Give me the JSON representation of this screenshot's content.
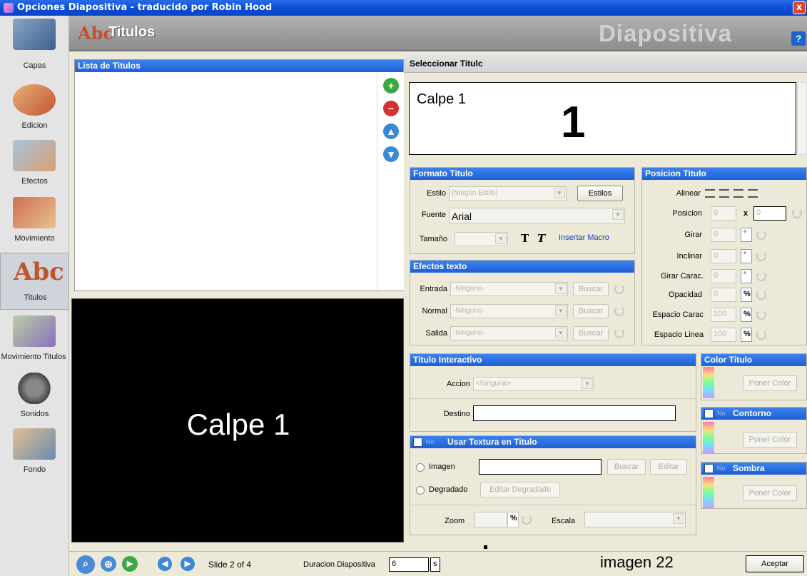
{
  "window": {
    "title": "Opciones Diapositiva - traducido por Robin Hood",
    "close": "x"
  },
  "sidebar": {
    "items": [
      {
        "label": "Capas"
      },
      {
        "label": "Edicion"
      },
      {
        "label": "Efectos"
      },
      {
        "label": "Movimiento"
      },
      {
        "label": "Titulos"
      },
      {
        "label": "Movimiento Titulos"
      },
      {
        "label": "Sonidos"
      },
      {
        "label": "Fondo"
      }
    ]
  },
  "header": {
    "title": "Titulos",
    "watermark": "Diapositiva",
    "help": "?"
  },
  "lista": {
    "title": "Lista de Titulos"
  },
  "preview": {
    "text": "Calpe 1"
  },
  "select": {
    "title": "Seleccionar Titulc",
    "text": "Calpe 1",
    "overlay_number": "1"
  },
  "formato": {
    "title": "Formato Titulo",
    "estilo_label": "Estilo",
    "estilo_value": "[Ningún Estilo]",
    "estilos_btn": "Estilos",
    "fuente_label": "Fuente",
    "fuente_value": "Arial",
    "tamano_label": "Tamaño",
    "bold_glyph": "T",
    "italic_glyph": "T",
    "macro_link": "Insertar Macro"
  },
  "efectos": {
    "title": "Efectos texto",
    "rows": [
      {
        "label": "Entrada",
        "value": "-Ninguno-",
        "btn": "Buscar"
      },
      {
        "label": "Normal",
        "value": "-Ninguno-",
        "btn": "Buscar"
      },
      {
        "label": "Salida",
        "value": "-Ninguno-",
        "btn": "Buscar"
      }
    ]
  },
  "posicion": {
    "title": "Posicion Titulo",
    "alinear": "Alinear",
    "posicion_label": "Posicion",
    "pos_x": "0",
    "pos_sep": "x",
    "pos_y": "0",
    "girar_label": "Girar",
    "girar_value": "0",
    "deg": "°",
    "inclinar_label": "Inclinar",
    "inclinar_value": "0",
    "girarcarac_label": "Girar Carac.",
    "girarcarac_value": "0",
    "opacidad_label": "Opacidad",
    "opacidad_value": "0",
    "pct": "%",
    "espcarac_label": "Espacio Carac",
    "espcarac_value": "100",
    "esplinea_label": "Espacio Linea",
    "esplinea_value": "100"
  },
  "interactivo": {
    "title": "Titulo Interactivo",
    "accion_label": "Accion",
    "accion_value": "<Ninguna>",
    "destino_label": "Destino"
  },
  "color": {
    "title": "Color Titulo",
    "btn": "Poner Color"
  },
  "contorno": {
    "no": "No",
    "title": "Contorno",
    "btn": "Poner Color"
  },
  "sombra": {
    "no": "No",
    "title": "Sombra",
    "btn": "Poner Color"
  },
  "textura": {
    "no": "No",
    "title": "Usar Textura en Titulo",
    "imagen_label": "Imagen",
    "buscar": "Buscar",
    "editar": "Editar",
    "degradado_label": "Degradado",
    "editar_degradado": "Editar Degradado",
    "zoom_label": "Zoom",
    "pct": "%",
    "escala_label": "Escala"
  },
  "footer": {
    "slide": "Slide 2 of 4",
    "duracion_label": "Duracion Diapositiva",
    "duracion_value": "6",
    "unit": "s",
    "caption": "imagen 22",
    "aceptar": "Aceptar"
  }
}
